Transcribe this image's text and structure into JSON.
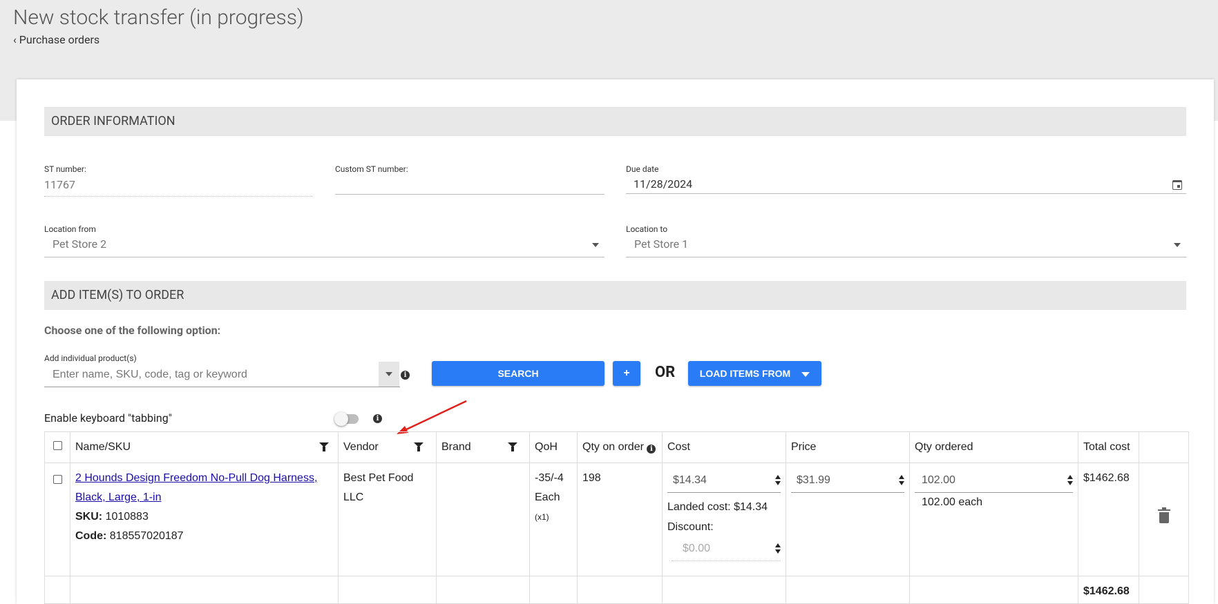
{
  "header": {
    "title": "New stock transfer (in progress)",
    "breadcrumb": "Purchase orders",
    "breadcrumb_icon": "chevron-left-icon"
  },
  "order_info": {
    "section_title": "ORDER INFORMATION",
    "st_number_label": "ST number:",
    "st_number_value": "11767",
    "custom_st_label": "Custom ST number:",
    "custom_st_value": "",
    "due_date_label": "Due date",
    "due_date_value": "11/28/2024",
    "location_from_label": "Location from",
    "location_from_value": "Pet Store 2",
    "location_to_label": "Location to",
    "location_to_value": "Pet Store 1"
  },
  "add_items": {
    "section_title": "ADD ITEM(S) TO ORDER",
    "choose_text": "Choose one of the following option:",
    "individual_label": "Add individual product(s)",
    "search_placeholder": "Enter name, SKU, code, tag or keyword",
    "search_button": "SEARCH",
    "plus_button": "+",
    "or_text": "OR",
    "load_button": "LOAD ITEMS FROM"
  },
  "tabbing": {
    "label": "Enable keyboard \"tabbing\"",
    "enabled": false
  },
  "table": {
    "headers": {
      "name": "Name/SKU",
      "vendor": "Vendor",
      "brand": "Brand",
      "qoh": "QoH",
      "qty_on_order": "Qty on order",
      "cost": "Cost",
      "price": "Price",
      "qty_ordered": "Qty ordered",
      "total_cost": "Total cost"
    },
    "rows": [
      {
        "name": "2 Hounds Design Freedom No-Pull Dog Harness, Black, Large, 1-in",
        "sku_label": "SKU:",
        "sku": "1010883",
        "code_label": "Code:",
        "code": "818557020187",
        "vendor": "Best Pet Food LLC",
        "brand": "",
        "qoh": "-35/-4",
        "qoh_unit": "Each",
        "qoh_mult": "(x1)",
        "qty_on_order": "198",
        "cost": "$14.34",
        "landed_cost": "Landed cost: $14.34",
        "discount_label": "Discount:",
        "discount": "$0.00",
        "price": "$31.99",
        "qty_ordered": "102.00",
        "qty_each": "102.00 each",
        "total_cost": "$1462.68"
      }
    ],
    "footer_total": "$1462.68"
  }
}
